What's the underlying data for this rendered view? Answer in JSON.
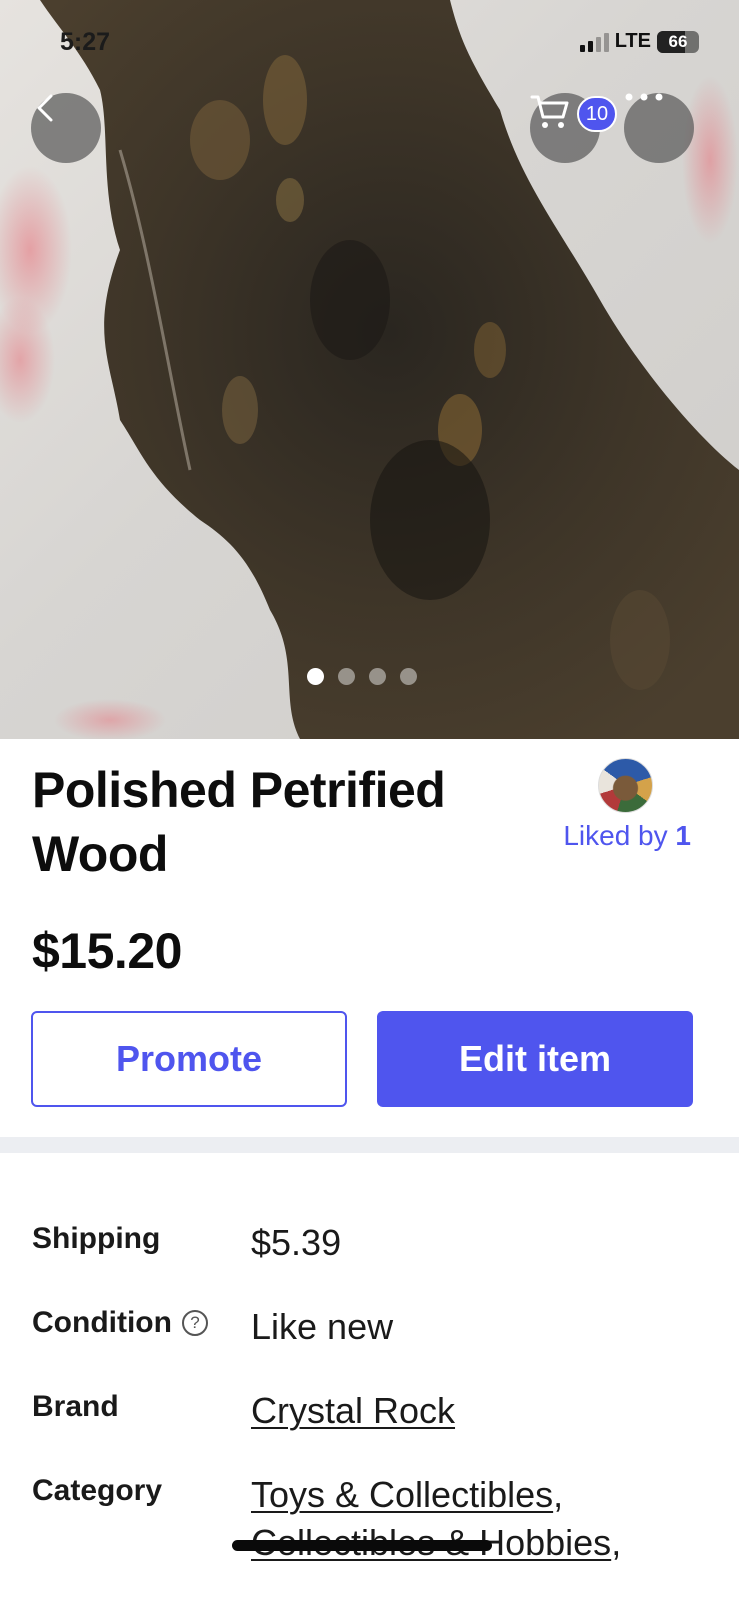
{
  "status_bar": {
    "time": "5:27",
    "network": "LTE",
    "battery": "66",
    "battery_level": 0.66
  },
  "header": {
    "back_icon": "chevron-left-icon",
    "cart_icon": "cart-icon",
    "cart_count": "10",
    "more_icon": "more-horizontal-icon"
  },
  "gallery": {
    "image_count": 4,
    "active_index": 0
  },
  "item": {
    "title": "Polished Petrified Wood",
    "liked_by_label": "Liked by",
    "liked_by_count": "1",
    "price": "$15.20"
  },
  "actions": {
    "promote_label": "Promote",
    "edit_label": "Edit item"
  },
  "details": {
    "shipping_label": "Shipping",
    "shipping_value": "$5.39",
    "condition_label": "Condition",
    "condition_value": "Like new",
    "brand_label": "Brand",
    "brand_value": "Crystal Rock",
    "category_label": "Category",
    "category_value_1": "Toys & Collectibles",
    "category_sep_1": ",",
    "category_value_2": "Collectibles & Hobbies",
    "category_sep_2": ","
  },
  "colors": {
    "accent": "#4f55ee",
    "divider": "#eceef2"
  }
}
